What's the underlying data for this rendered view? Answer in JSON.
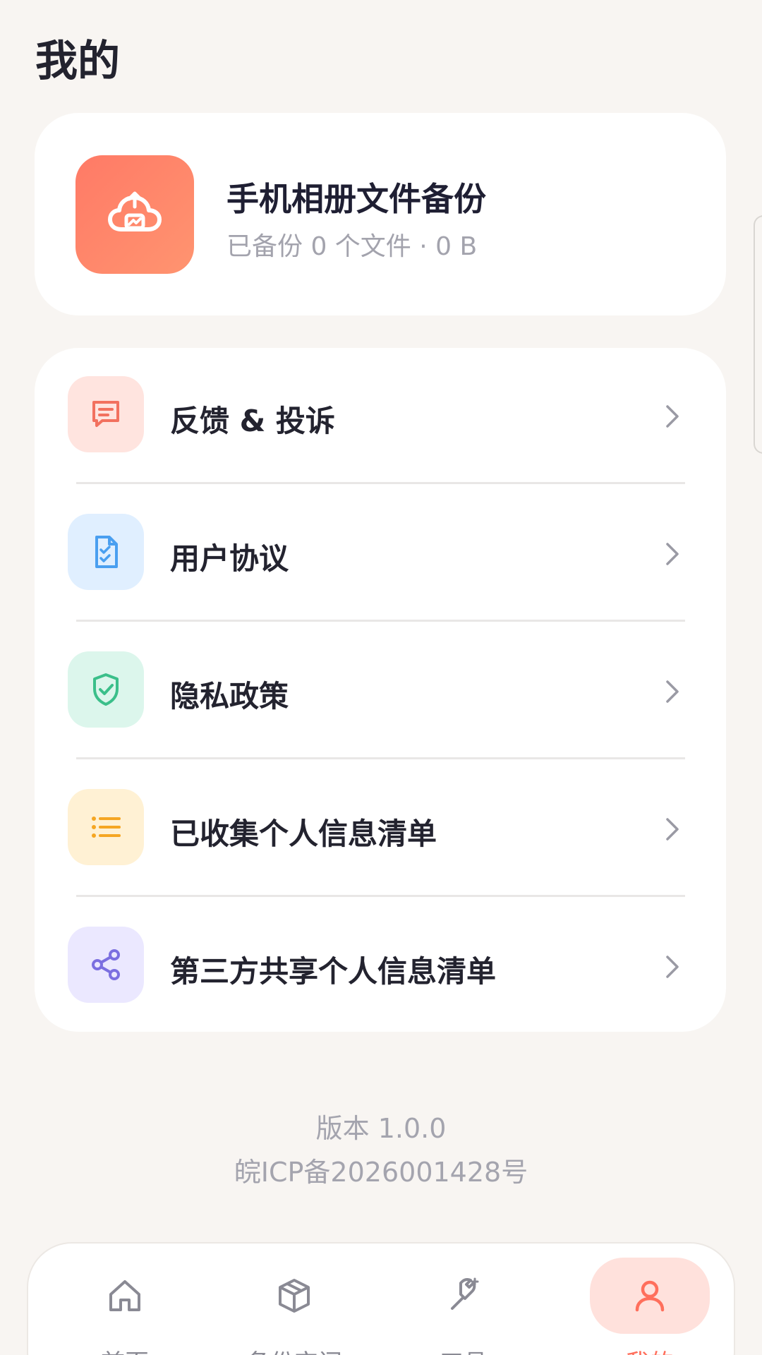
{
  "header": {
    "title": "我的"
  },
  "backup": {
    "title": "手机相册文件备份",
    "subtitle": "已备份 0 个文件 · 0 B"
  },
  "menu": {
    "items": [
      {
        "label": "反馈 & 投诉",
        "icon": "message-icon"
      },
      {
        "label": "用户协议",
        "icon": "document-check-icon"
      },
      {
        "label": "隐私政策",
        "icon": "shield-check-icon"
      },
      {
        "label": "已收集个人信息清单",
        "icon": "list-icon"
      },
      {
        "label": "第三方共享个人信息清单",
        "icon": "share-icon"
      }
    ]
  },
  "footer": {
    "version": "版本 1.0.0",
    "icp": "皖ICP备2026001428号"
  },
  "tabbar": {
    "tabs": [
      {
        "label": "首页",
        "icon": "home-icon",
        "active": false
      },
      {
        "label": "备份空间",
        "icon": "box-icon",
        "active": false
      },
      {
        "label": "工具",
        "icon": "tool-icon",
        "active": false
      },
      {
        "label": "我的",
        "icon": "user-icon",
        "active": true
      }
    ]
  },
  "colors": {
    "background": "#f8f5f2",
    "accent": "#ff6f5c",
    "card": "#ffffff"
  }
}
